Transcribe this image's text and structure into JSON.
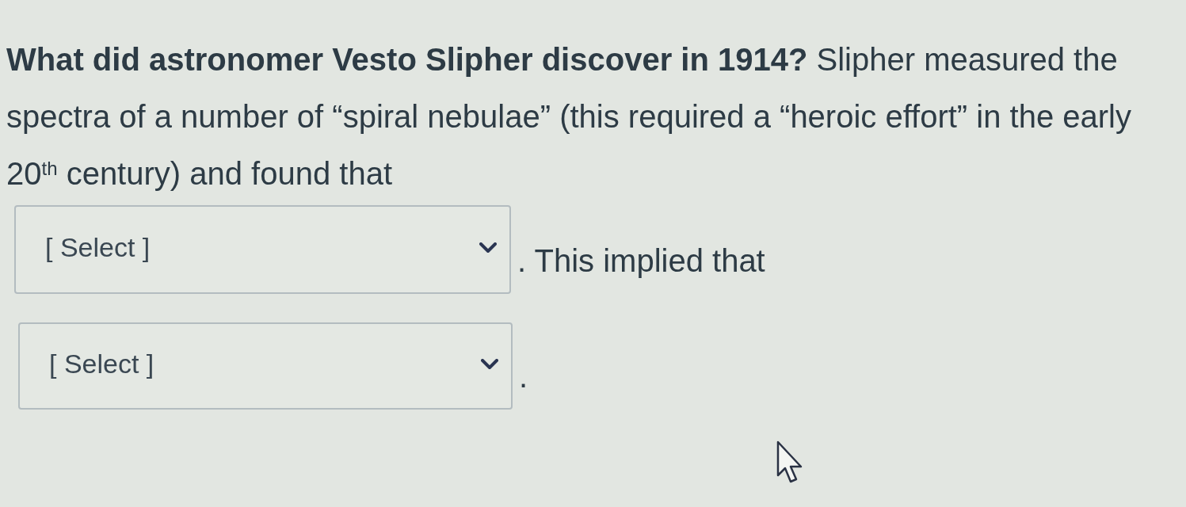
{
  "question": {
    "text": "**What did astronomer Vesto Slipher discover in 1914?** Slipher measured the spectra of a number of “spiral nebulae” (this required a “heroic effort” in the early 20$^{th}$ century) and found that"
  },
  "blanks": [
    {
      "placeholder": "[ Select ]",
      "trailing_text": ". This implied that"
    },
    {
      "placeholder": "[ Select ]",
      "trailing_text": "."
    }
  ]
}
